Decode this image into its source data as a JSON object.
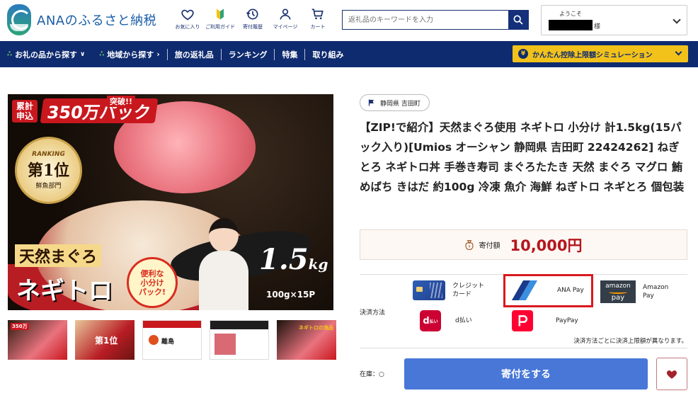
{
  "header": {
    "logo_text": "ANAのふるさと納税",
    "icons": [
      {
        "label": "お気に入り",
        "icon": "heart-icon"
      },
      {
        "label": "ご利用ガイド",
        "icon": "guide-icon"
      },
      {
        "label": "寄付履歴",
        "icon": "history-icon"
      },
      {
        "label": "マイページ",
        "icon": "user-icon"
      },
      {
        "label": "カート",
        "icon": "cart-icon"
      }
    ],
    "search_placeholder": "返礼品のキーワードを入力",
    "account": {
      "welcome": "ようこそ",
      "suffix": "様"
    }
  },
  "nav": {
    "items": [
      {
        "label": "お礼の品から探す"
      },
      {
        "label": "地域から探す"
      },
      {
        "label": "旅の返礼品"
      },
      {
        "label": "ランキング"
      },
      {
        "label": "特集"
      },
      {
        "label": "取り組み"
      }
    ],
    "simulation": "かんたん控除上限額シミュレーション"
  },
  "main_image": {
    "banner_small": "累計\n申込",
    "banner_big": "350万パック",
    "banner_tag": "突破!!",
    "ranking_label": "RANKING",
    "ranking_rank": "第1位",
    "ranking_cat": "鮮魚部門",
    "tennen": "天然まぐろ",
    "product": "ネギトロ",
    "benri": "便利な\n小分け\nパック!",
    "weight": "1.5",
    "weight_unit": "kg",
    "weight_sub": "100g×15P"
  },
  "thumbnails": [
    {
      "label": "350万"
    },
    {
      "label": "第1位"
    },
    {
      "label": "離島"
    },
    {
      "label": ""
    },
    {
      "label": "ネギトロの逸品"
    }
  ],
  "product": {
    "location": "静岡県 吉田町",
    "title": "【ZIP!で紹介】天然まぐろ使用 ネギトロ 小分け 計1.5kg(15パック入り)[Umios オーシャン 静岡県 吉田町 22424262] ねぎとろ ネギトロ丼 手巻き寿司 まぐろたたき 天然 まぐろ マグロ 鮪 めばち きはだ 約100g 冷凍 魚介 海鮮 ねぎトロ ネギとろ 個包装",
    "price_label": "寄付額",
    "price": "10,000円"
  },
  "payment": {
    "label": "決済方法",
    "methods": [
      {
        "name": "クレジット\nカード"
      },
      {
        "name": "ANA Pay"
      },
      {
        "name": "Amazon\nPay"
      },
      {
        "name": "d払い"
      },
      {
        "name": "PayPay"
      }
    ],
    "note": "決済方法ごとに決済上限額が異なります。"
  },
  "stock": {
    "label": "在庫：",
    "value": "○"
  },
  "donate_button": "寄付をする",
  "colors": {
    "navy": "#0e2b6f",
    "accent_yellow": "#f3c21a",
    "price_red": "#b5161d",
    "button_blue": "#4877d8",
    "highlight_red": "#d9191e"
  }
}
